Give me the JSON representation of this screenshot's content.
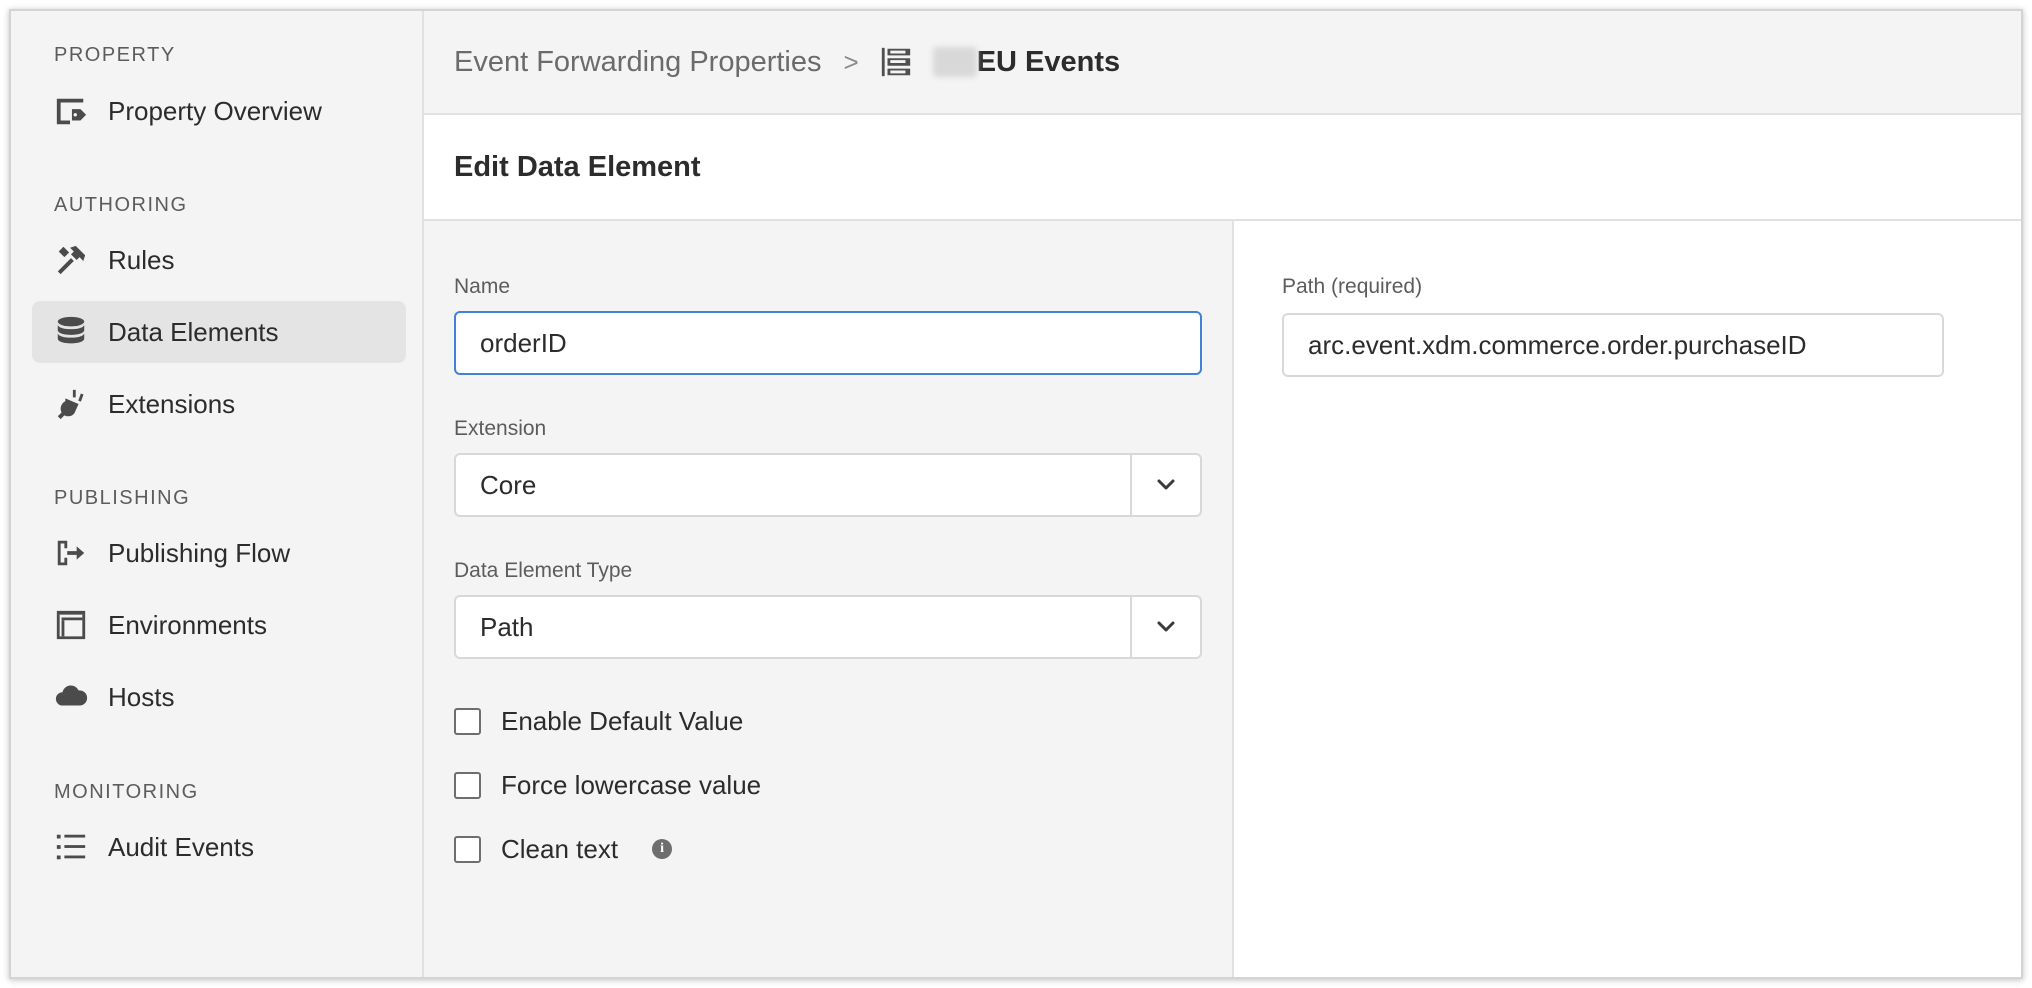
{
  "sidebar": {
    "sections": [
      {
        "label": "PROPERTY"
      },
      {
        "label": "AUTHORING"
      },
      {
        "label": "PUBLISHING"
      },
      {
        "label": "MONITORING"
      }
    ],
    "items": [
      {
        "label": "Property Overview",
        "icon": "property-overview-icon",
        "active": false
      },
      {
        "label": "Rules",
        "icon": "rules-icon",
        "active": false
      },
      {
        "label": "Data Elements",
        "icon": "database-icon",
        "active": true
      },
      {
        "label": "Extensions",
        "icon": "plug-icon",
        "active": false
      },
      {
        "label": "Publishing Flow",
        "icon": "publish-flow-icon",
        "active": false
      },
      {
        "label": "Environments",
        "icon": "window-icon",
        "active": false
      },
      {
        "label": "Hosts",
        "icon": "cloud-icon",
        "active": false
      },
      {
        "label": "Audit Events",
        "icon": "list-icon",
        "active": false
      }
    ]
  },
  "header": {
    "breadcrumb_parent": "Event Forwarding Properties",
    "breadcrumb_separator": ">",
    "breadcrumb_current": "EU Events"
  },
  "page": {
    "title": "Edit Data Element"
  },
  "form": {
    "name": {
      "label": "Name",
      "value": "orderID"
    },
    "extension": {
      "label": "Extension",
      "value": "Core"
    },
    "type": {
      "label": "Data Element Type",
      "value": "Path"
    },
    "checkboxes": [
      {
        "label": "Enable Default Value",
        "checked": false
      },
      {
        "label": "Force lowercase value",
        "checked": false
      },
      {
        "label": "Clean text",
        "checked": false,
        "info": "i"
      }
    ]
  },
  "config": {
    "path": {
      "label": "Path (required)",
      "value": "arc.event.xdm.commerce.order.purchaseID"
    }
  },
  "colors": {
    "focus": "#3f82d8",
    "active_nav": "#e4e4e4",
    "sidebar_bg": "#f4f4f4"
  }
}
